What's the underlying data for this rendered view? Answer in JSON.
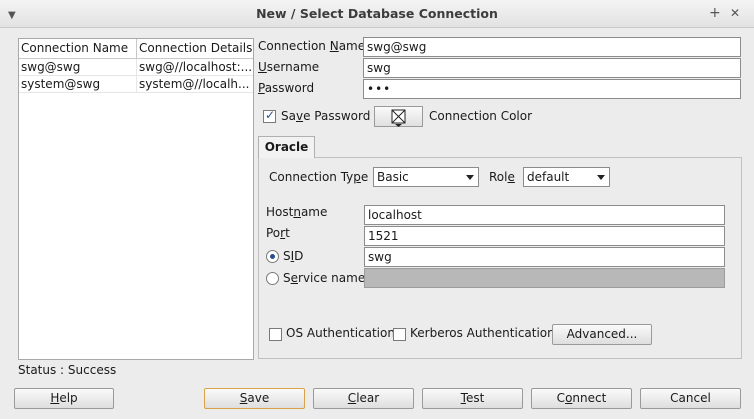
{
  "window": {
    "title": "New / Select Database Connection",
    "plus_glyph": "+",
    "close_glyph": "✕"
  },
  "connection_list": {
    "headers": [
      "Connection Name",
      "Connection Details"
    ],
    "rows": [
      {
        "name": "swg@swg",
        "details": "swg@//localhost:..."
      },
      {
        "name": "system@swg",
        "details": "system@//localh..."
      }
    ]
  },
  "form": {
    "connection_name": {
      "label_pre": "Connection ",
      "label_ul": "N",
      "label_post": "ame",
      "value": "swg@swg"
    },
    "username": {
      "label_pre": "",
      "label_ul": "U",
      "label_post": "sername",
      "value": "swg"
    },
    "password": {
      "label_pre": "",
      "label_ul": "P",
      "label_post": "assword",
      "value": "•••"
    },
    "save_password": {
      "label_pre": "Sa",
      "label_ul": "v",
      "label_post": "e Password",
      "checked": true
    },
    "connection_color_label": "Connection Color"
  },
  "tabs": [
    {
      "label": "Oracle",
      "selected": true
    }
  ],
  "oracle": {
    "connection_type": {
      "label_pre": "Connection Ty",
      "label_ul": "p",
      "label_post": "e",
      "value": "Basic"
    },
    "role": {
      "label_pre": "Rol",
      "label_ul": "e",
      "label_post": "",
      "value": "default"
    },
    "hostname": {
      "label_pre": "Host",
      "label_ul": "n",
      "label_post": "ame",
      "value": "localhost"
    },
    "port": {
      "label_pre": "Po",
      "label_ul": "r",
      "label_post": "t",
      "value": "1521"
    },
    "sid": {
      "label_pre": "S",
      "label_ul": "I",
      "label_post": "D",
      "value": "swg",
      "selected": true
    },
    "service_name": {
      "label_pre": "S",
      "label_ul": "e",
      "label_post": "rvice name",
      "value": "",
      "selected": false
    },
    "os_auth": {
      "label": "OS Authentication",
      "checked": false
    },
    "kerberos_auth": {
      "label": "Kerberos Authentication",
      "checked": false
    },
    "advanced_label": "Advanced..."
  },
  "status": {
    "text": "Status : Success"
  },
  "buttons": {
    "help": {
      "label_pre": "",
      "label_ul": "H",
      "label_post": "elp"
    },
    "save": {
      "label_pre": "",
      "label_ul": "S",
      "label_post": "ave"
    },
    "clear": {
      "label_pre": "",
      "label_ul": "C",
      "label_post": "lear"
    },
    "test": {
      "label_pre": "",
      "label_ul": "T",
      "label_post": "est"
    },
    "connect": {
      "label_pre": "C",
      "label_ul": "o",
      "label_post": "nnect"
    },
    "cancel": {
      "label_pre": "Cancel",
      "label_ul": "",
      "label_post": ""
    }
  },
  "colors": {
    "accent": "#2a4e8c",
    "default_button_border": "#d9a24a",
    "disabled_field": "#b8b8b8"
  }
}
